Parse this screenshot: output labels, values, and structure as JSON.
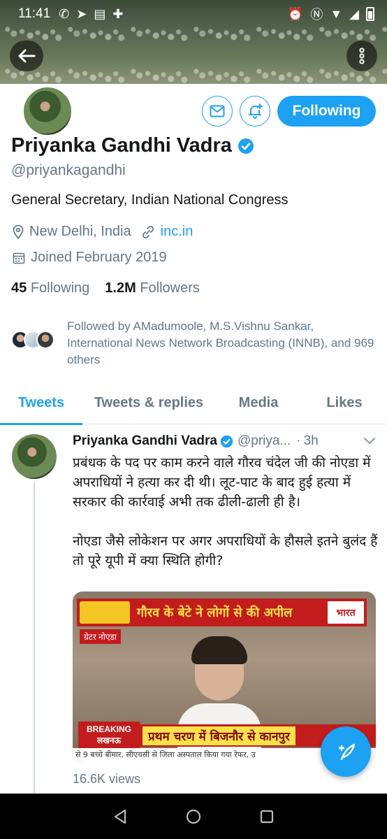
{
  "status_bar": {
    "time": "11:41",
    "left_icons": [
      "whatsapp-icon",
      "telegram-icon",
      "app-icon",
      "add-person-icon"
    ],
    "right_icons": [
      "alarm-icon",
      "nfc-icon",
      "wifi-icon",
      "signal-icon",
      "battery-icon"
    ]
  },
  "profile": {
    "name": "Priyanka Gandhi Vadra",
    "verified": true,
    "handle": "@priyankagandhi",
    "bio": "General Secretary, Indian National Congress",
    "location": "New Delhi, India",
    "website": "inc.in",
    "joined": "Joined February 2019",
    "following_count": "45",
    "following_label": "Following",
    "followers_count": "1.2M",
    "followers_label": "Followers",
    "follow_button": "Following",
    "followed_by": "Followed by AMadumoole, M.S.Vishnu Sankar, International News Network Broadcasting (INNB), and 969 others"
  },
  "tabs": [
    {
      "label": "Tweets",
      "active": true
    },
    {
      "label": "Tweets & replies",
      "active": false
    },
    {
      "label": "Media",
      "active": false
    },
    {
      "label": "Likes",
      "active": false
    }
  ],
  "tweet": {
    "author": "Priyanka Gandhi Vadra",
    "handle": "@priya...",
    "separator": "·",
    "time": "3h",
    "text": "प्रबंधक के पद पर काम करने वाले गौरव चंदेल जी की नोएडा में अपराधियों ने हत्या कर दी थी। लूट-पाट के बाद हुई हत्या में सरकार की कार्रवाई अभी तक ढीली-ढाली ही है।\n\nनोएडा जैसे लोकेशन पर अगर अपराधियों के हौसले इतने बुलंद हैं तो पूरे यूपी में क्या स्थिति होगी?",
    "media": {
      "top_headline": "गौरव के बेटे ने लोगों से की अपील",
      "channel_logo": "भारत",
      "place_tag": "ग्रेटर नोएडा",
      "breaking_label": "BREAKING",
      "breaking_city": "लखनऊ",
      "lower_third": "प्रथम चरण में बिजनौर से कानपुर",
      "ticker": "से 9 बच्चे बीमार, सीएचसी से जिला अस्पताल किया गया रेफर, उ"
    },
    "views": "16.6K views"
  },
  "colors": {
    "accent": "#1da1f2",
    "text_primary": "#14171a",
    "text_secondary": "#657786"
  }
}
